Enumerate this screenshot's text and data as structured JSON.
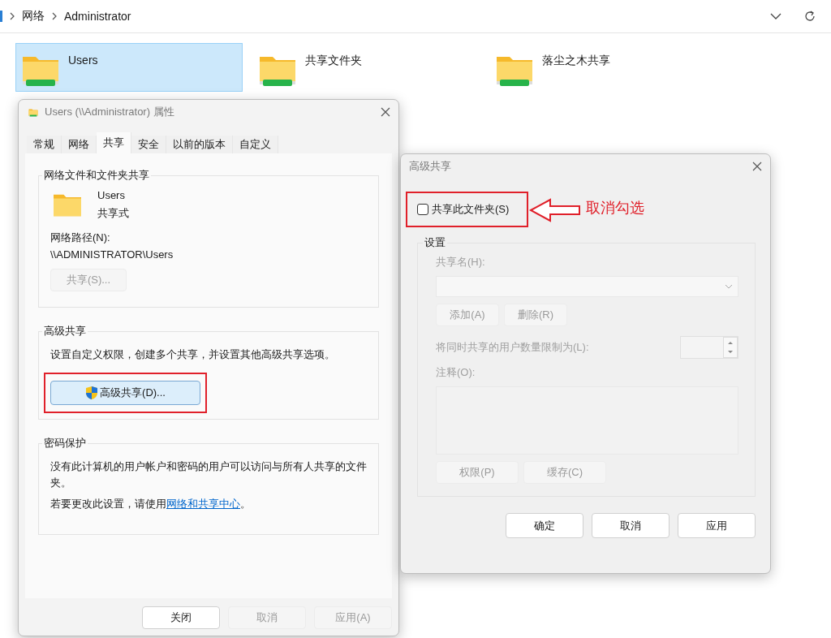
{
  "explorer": {
    "breadcrumb": [
      "网络",
      "Administrator"
    ],
    "items": [
      {
        "name": "Users",
        "selected": true
      },
      {
        "name": "共享文件夹",
        "selected": false
      },
      {
        "name": "落尘之木共享",
        "selected": false
      }
    ]
  },
  "properties_dialog": {
    "title": "Users (\\\\Administrator) 属性",
    "tabs": [
      {
        "label": "常规",
        "selected": false
      },
      {
        "label": "网络",
        "selected": false
      },
      {
        "label": "共享",
        "selected": true
      },
      {
        "label": "安全",
        "selected": false
      },
      {
        "label": "以前的版本",
        "selected": false
      },
      {
        "label": "自定义",
        "selected": false
      }
    ],
    "network_sharing": {
      "heading": "网络文件和文件夹共享",
      "folder_name": "Users",
      "status": "共享式",
      "path_label": "网络路径(N):",
      "path": "\\\\ADMINISTRATOR\\Users",
      "share_button": {
        "label": "共享(S)...",
        "disabled": true
      }
    },
    "advanced_sharing": {
      "heading": "高级共享",
      "description": "设置自定义权限，创建多个共享，并设置其他高级共享选项。",
      "button": "高级共享(D)..."
    },
    "password_protection": {
      "heading": "密码保护",
      "description": "没有此计算机的用户帐户和密码的用户可以访问与所有人共享的文件夹。",
      "hint": "若要更改此设置，请使用",
      "link": "网络和共享中心",
      "hint_end": "。"
    },
    "buttons": [
      {
        "label": "关闭",
        "disabled": false
      },
      {
        "label": "取消",
        "disabled": true
      },
      {
        "label": "应用(A)",
        "disabled": true
      }
    ]
  },
  "advanced_dialog": {
    "title": "高级共享",
    "share_checkbox": {
      "label": "共享此文件夹(S)",
      "checked": false
    },
    "settings": {
      "heading": "设置",
      "disabled": true,
      "share_name_label": "共享名(H):",
      "share_buttons": [
        "添加(A)",
        "删除(R)"
      ],
      "user_limit_label": "将同时共享的用户数量限制为(L):",
      "comment_label": "注释(O):",
      "bottom_buttons": [
        "权限(P)",
        "缓存(C)"
      ]
    },
    "buttons": [
      {
        "label": "确定",
        "disabled": false
      },
      {
        "label": "取消",
        "disabled": false
      },
      {
        "label": "应用",
        "disabled": false
      }
    ]
  },
  "annotation": {
    "text": "取消勾选"
  }
}
